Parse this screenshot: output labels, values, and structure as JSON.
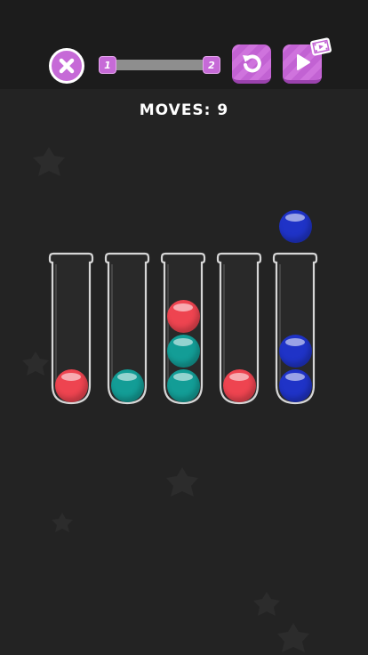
{
  "header": {
    "level_from": "1",
    "level_to": "2",
    "progress": 0
  },
  "moves_text": "MOVES: 9",
  "colors": {
    "accent": "#c66ad7",
    "background": "#232323",
    "red": "#ee4450",
    "teal": "#139d96",
    "blue": "#1f33c7"
  },
  "icons": {
    "close": "close-icon",
    "undo": "undo-icon",
    "skip": "play-icon",
    "ad": "video-ad-icon"
  },
  "tubes": [
    {
      "balls": [
        "red"
      ]
    },
    {
      "balls": [
        "teal"
      ]
    },
    {
      "balls": [
        "teal",
        "teal",
        "red"
      ]
    },
    {
      "balls": [
        "red"
      ]
    },
    {
      "balls": [
        "blue",
        "blue"
      ]
    }
  ],
  "lifted_ball": {
    "color": "blue",
    "tube": 5
  }
}
